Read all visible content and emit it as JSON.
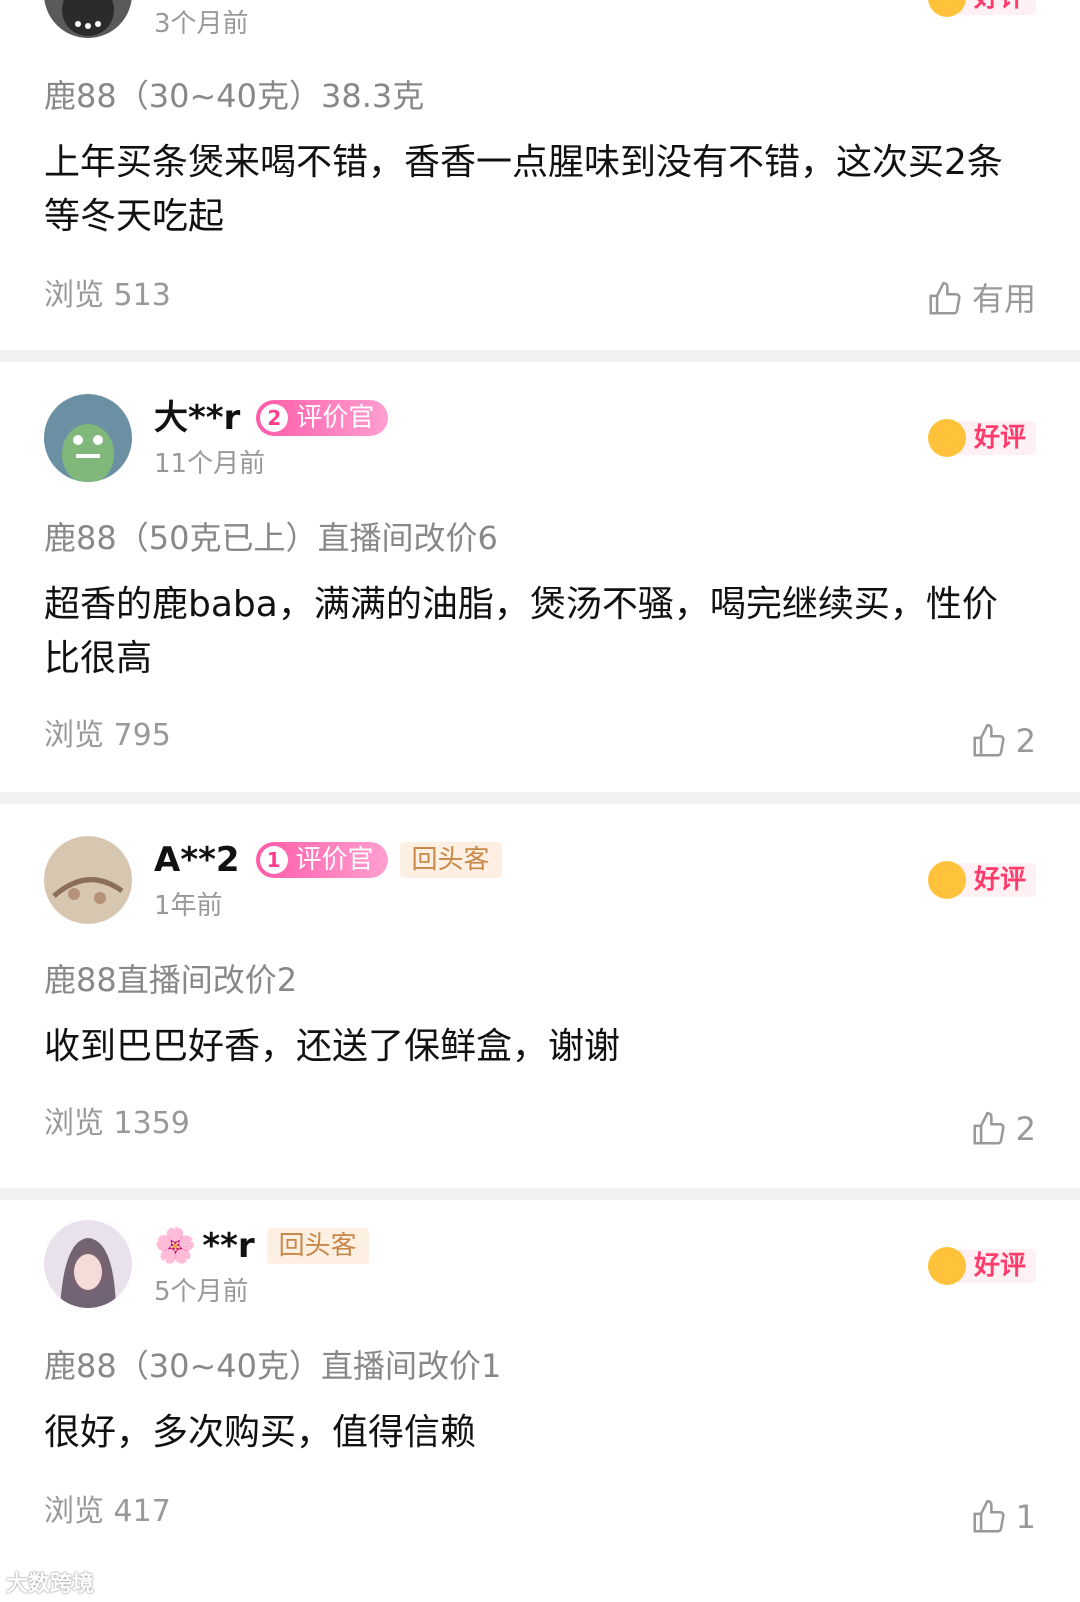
{
  "reviews": [
    {
      "username": "",
      "time": "3个月前",
      "rating": "好评",
      "spec": "鹿88（30~40克）38.3克",
      "content": "上年买条煲来喝不错，香香一点腥味到没有不错，这次买2条等冬天吃起",
      "views": "浏览 513",
      "like": "有用"
    },
    {
      "username": "大**r",
      "reviewer_level": "2",
      "reviewer_badge": "评价官",
      "time": "11个月前",
      "rating": "好评",
      "spec": "鹿88（50克已上）直播间改价6",
      "content": "超香的鹿baba，满满的油脂，煲汤不骚，喝完继续买，性价比很高",
      "views": "浏览 795",
      "like": "2"
    },
    {
      "username": "A**2",
      "reviewer_level": "1",
      "reviewer_badge": "评价官",
      "return_badge": "回头客",
      "time": "1年前",
      "rating": "好评",
      "spec": "鹿88直播间改价2",
      "content": "收到巴巴好香，还送了保鲜盒，谢谢",
      "views": "浏览 1359",
      "like": "2"
    },
    {
      "username_prefix": "🌸",
      "username": "**r",
      "return_badge": "回头客",
      "time": "5个月前",
      "rating": "好评",
      "spec": "鹿88（30~40克）直播间改价1",
      "content": "很好，多次购买，值得信赖",
      "views": "浏览 417",
      "like": "1"
    }
  ],
  "watermark": "大数跨境",
  "colors": {
    "rating_text": "#ff3b6b",
    "reviewer_badge": "#ff5ba8",
    "return_badge_text": "#c8884a",
    "muted": "#999999"
  },
  "icons": [
    "thumbs-up-icon",
    "smile-face-icon",
    "avatar-image"
  ]
}
